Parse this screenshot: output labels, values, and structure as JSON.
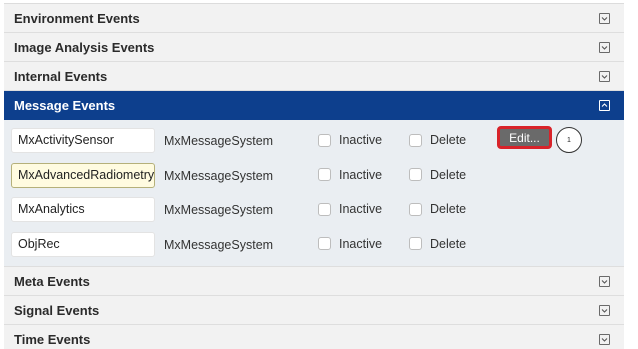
{
  "sections_top": [
    {
      "title": "Environment Events",
      "icon": "chevron-down-icon"
    },
    {
      "title": "Image Analysis Events",
      "icon": "chevron-down-icon"
    },
    {
      "title": "Internal Events",
      "icon": "chevron-down-icon"
    }
  ],
  "message_events": {
    "title": "Message Events",
    "icon": "chevron-up-icon",
    "rows": [
      {
        "name": "MxActivitySensor",
        "system": "MxMessageSystem",
        "inactive_label": "Inactive",
        "delete_label": "Delete",
        "inactive_checked": false,
        "delete_checked": false
      },
      {
        "name": "MxAdvancedRadiometry",
        "system": "MxMessageSystem",
        "inactive_label": "Inactive",
        "delete_label": "Delete",
        "inactive_checked": false,
        "delete_checked": false
      },
      {
        "name": "MxAnalytics",
        "system": "MxMessageSystem",
        "inactive_label": "Inactive",
        "delete_label": "Delete",
        "inactive_checked": false,
        "delete_checked": false
      },
      {
        "name": "ObjRec",
        "system": "MxMessageSystem",
        "inactive_label": "Inactive",
        "delete_label": "Delete",
        "inactive_checked": false,
        "delete_checked": false
      }
    ],
    "edit_label": "Edit...",
    "callout_number": "1"
  },
  "sections_bottom": [
    {
      "title": "Meta Events",
      "icon": "chevron-down-icon"
    },
    {
      "title": "Signal Events",
      "icon": "chevron-down-icon"
    },
    {
      "title": "Time Events",
      "icon": "chevron-down-icon"
    }
  ],
  "colors": {
    "active_header": "#0d3f8d",
    "highlight_border": "#d8232a"
  }
}
